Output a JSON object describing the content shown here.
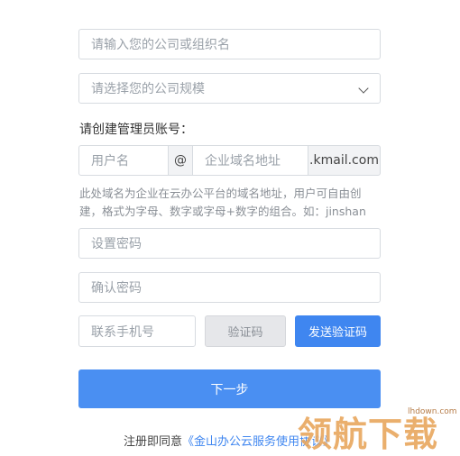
{
  "company_input": {
    "placeholder": "请输入您的公司或组织名"
  },
  "scale_select": {
    "placeholder": "请选择您的公司规模"
  },
  "admin_label": "请创建管理员账号：",
  "username_input": {
    "placeholder": "用户名"
  },
  "at_sign": "@",
  "domain_input": {
    "placeholder": "企业域名地址"
  },
  "domain_suffix": ".kmail.com",
  "domain_hint": "此处域名为企业在云办公平台的域名地址，用户可自由创建，格式为字母、数字或字母+数字的组合。如：jinshan",
  "password_input": {
    "placeholder": "设置密码"
  },
  "confirm_password_input": {
    "placeholder": "确认密码"
  },
  "phone_input": {
    "placeholder": "联系手机号"
  },
  "code_input": {
    "placeholder": "验证码"
  },
  "send_code_button": "发送验证码",
  "next_button": "下一步",
  "agreement": {
    "prefix": "注册即同意",
    "link": "《金山办公云服务使用协议》"
  },
  "watermark": {
    "text": "领航下载",
    "site": "lhdown.com"
  },
  "colors": {
    "primary": "#4a8ff2",
    "border": "#d7dbe0",
    "addon_bg": "#f2f3f5"
  }
}
